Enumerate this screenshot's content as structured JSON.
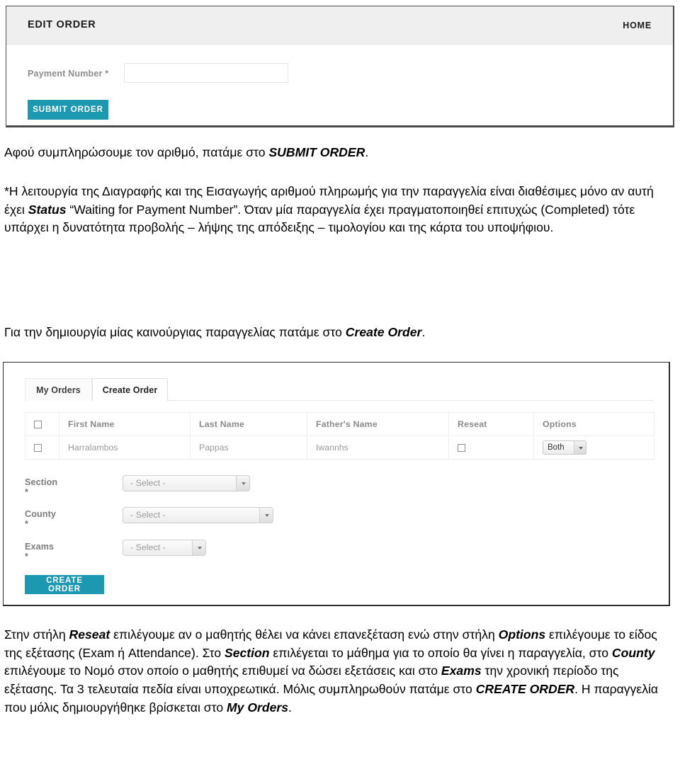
{
  "screenshot_edit_order": {
    "title": "EDIT ORDER",
    "home_link": "HOME",
    "payment_label": "Payment Number *",
    "payment_value": "",
    "payment_placeholder": "",
    "submit_button": "SUBMIT ORDER",
    "accent_color": "#1c98b0",
    "header_bg": "#efefef"
  },
  "paragraphs": {
    "p1": {
      "lead": "Αφού συμπληρώσουμε τον αριθμό, πατάμε  στο ",
      "bold": "SUBMIT ORDER",
      "tail": "."
    },
    "p2": {
      "seg1": "*Η λειτουργία της Διαγραφής και της Εισαγωγής αριθμού πληρωμής για την παραγγελία είναι διαθέσιμες μόνο αν αυτή έχει ",
      "bold1": "Status",
      "seg2": " “Waiting for Payment Number”. Όταν μία παραγγελία έχει πραγματοποιηθεί επιτυχώς (Completed) τότε υπάρχει η δυνατότητα προβολής – λήψης της απόδειξης – τιμολογίου και της κάρτα του υποψήφιου."
    },
    "p3": {
      "lead": "Για την δημιουργία μίας καινούργιας παραγγελίας πατάμε στο ",
      "bold": "Create Order",
      "tail": "."
    },
    "p4": {
      "seg1": "Στην στήλη ",
      "bold1": "Reseat",
      "seg2": " επιλέγουμε αν ο μαθητής θέλει να κάνει επανεξέταση ενώ στην στήλη ",
      "bold2": "Options",
      "seg3": " επιλέγουμε το είδος της εξέτασης (Exam ή Attendance). Στο ",
      "bold3": "Section",
      "seg4": " επιλέγεται το μάθημα για το οποίο θα γίνει η παραγγελία, στο ",
      "bold4": "County",
      "seg5": " επιλέγουμε το Νομό στον οποίο ο μαθητής επιθυμεί να δώσει εξετάσεις και στο ",
      "bold5": "Exams",
      "seg6": " την χρονική περίοδο της εξέτασης. Τα 3 τελευταία πεδία είναι υποχρεωτικά. Μόλις συμπληρωθούν πατάμε στο ",
      "bold6": "CREATE ORDER",
      "seg7": ". Η παραγγελία που μόλις δημιουργήθηκε βρίσκεται στο ",
      "bold7": "My Orders",
      "seg8": "."
    }
  },
  "screenshot_create_order": {
    "tabs": [
      {
        "label": "My Orders",
        "active": false
      },
      {
        "label": "Create Order",
        "active": true
      }
    ],
    "table": {
      "headers": [
        "",
        "First Name",
        "Last Name",
        "Father's Name",
        "Reseat",
        "Options"
      ],
      "rows": [
        {
          "selected": false,
          "first_name": "Harralambos",
          "last_name": "Pappas",
          "fathers_name": "Iwannhs",
          "reseat": false,
          "options_value": "Both"
        }
      ]
    },
    "fields": [
      {
        "label": "Section *",
        "value": "- Select -"
      },
      {
        "label": "County *",
        "value": "- Select -"
      },
      {
        "label": "Exams *",
        "value": "- Select -"
      }
    ],
    "create_button": "CREATE ORDER",
    "accent_color": "#1c98b0"
  }
}
